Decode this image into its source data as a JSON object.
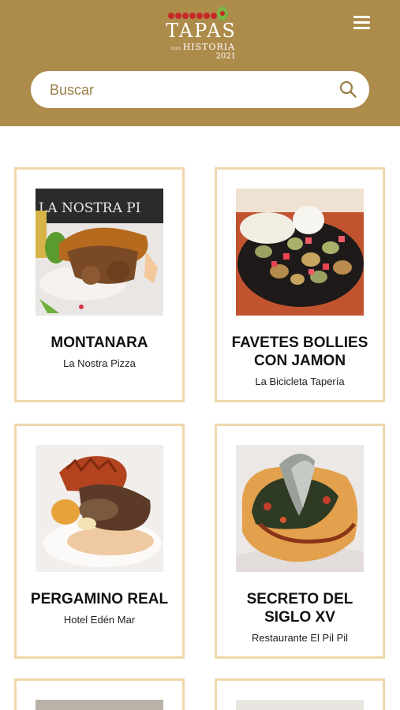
{
  "header": {
    "logo_main": "TAPAS",
    "logo_sub_small": "con",
    "logo_sub": "HISTORIA",
    "logo_year": "2021",
    "bg_color": "#ad8b4a"
  },
  "menu": {
    "icon": "hamburger-menu-icon"
  },
  "search": {
    "placeholder": "Buscar",
    "value": "",
    "icon": "search-icon"
  },
  "cards": [
    {
      "title": "MONTANARA",
      "place": "La Nostra Pizza",
      "photo_text": "LA NOSTRA PI"
    },
    {
      "title": "FAVETES BOLLIES CON JAMON",
      "place": "La Bicicleta Tapería"
    },
    {
      "title": "PERGAMINO REAL",
      "place": "Hotel Edén Mar"
    },
    {
      "title": "SECRETO DEL SIGLO XV",
      "place": "Restaurante El Pil Pil"
    }
  ],
  "colors": {
    "accent": "#ad8b4a",
    "card_border": "#f0d8ac"
  }
}
